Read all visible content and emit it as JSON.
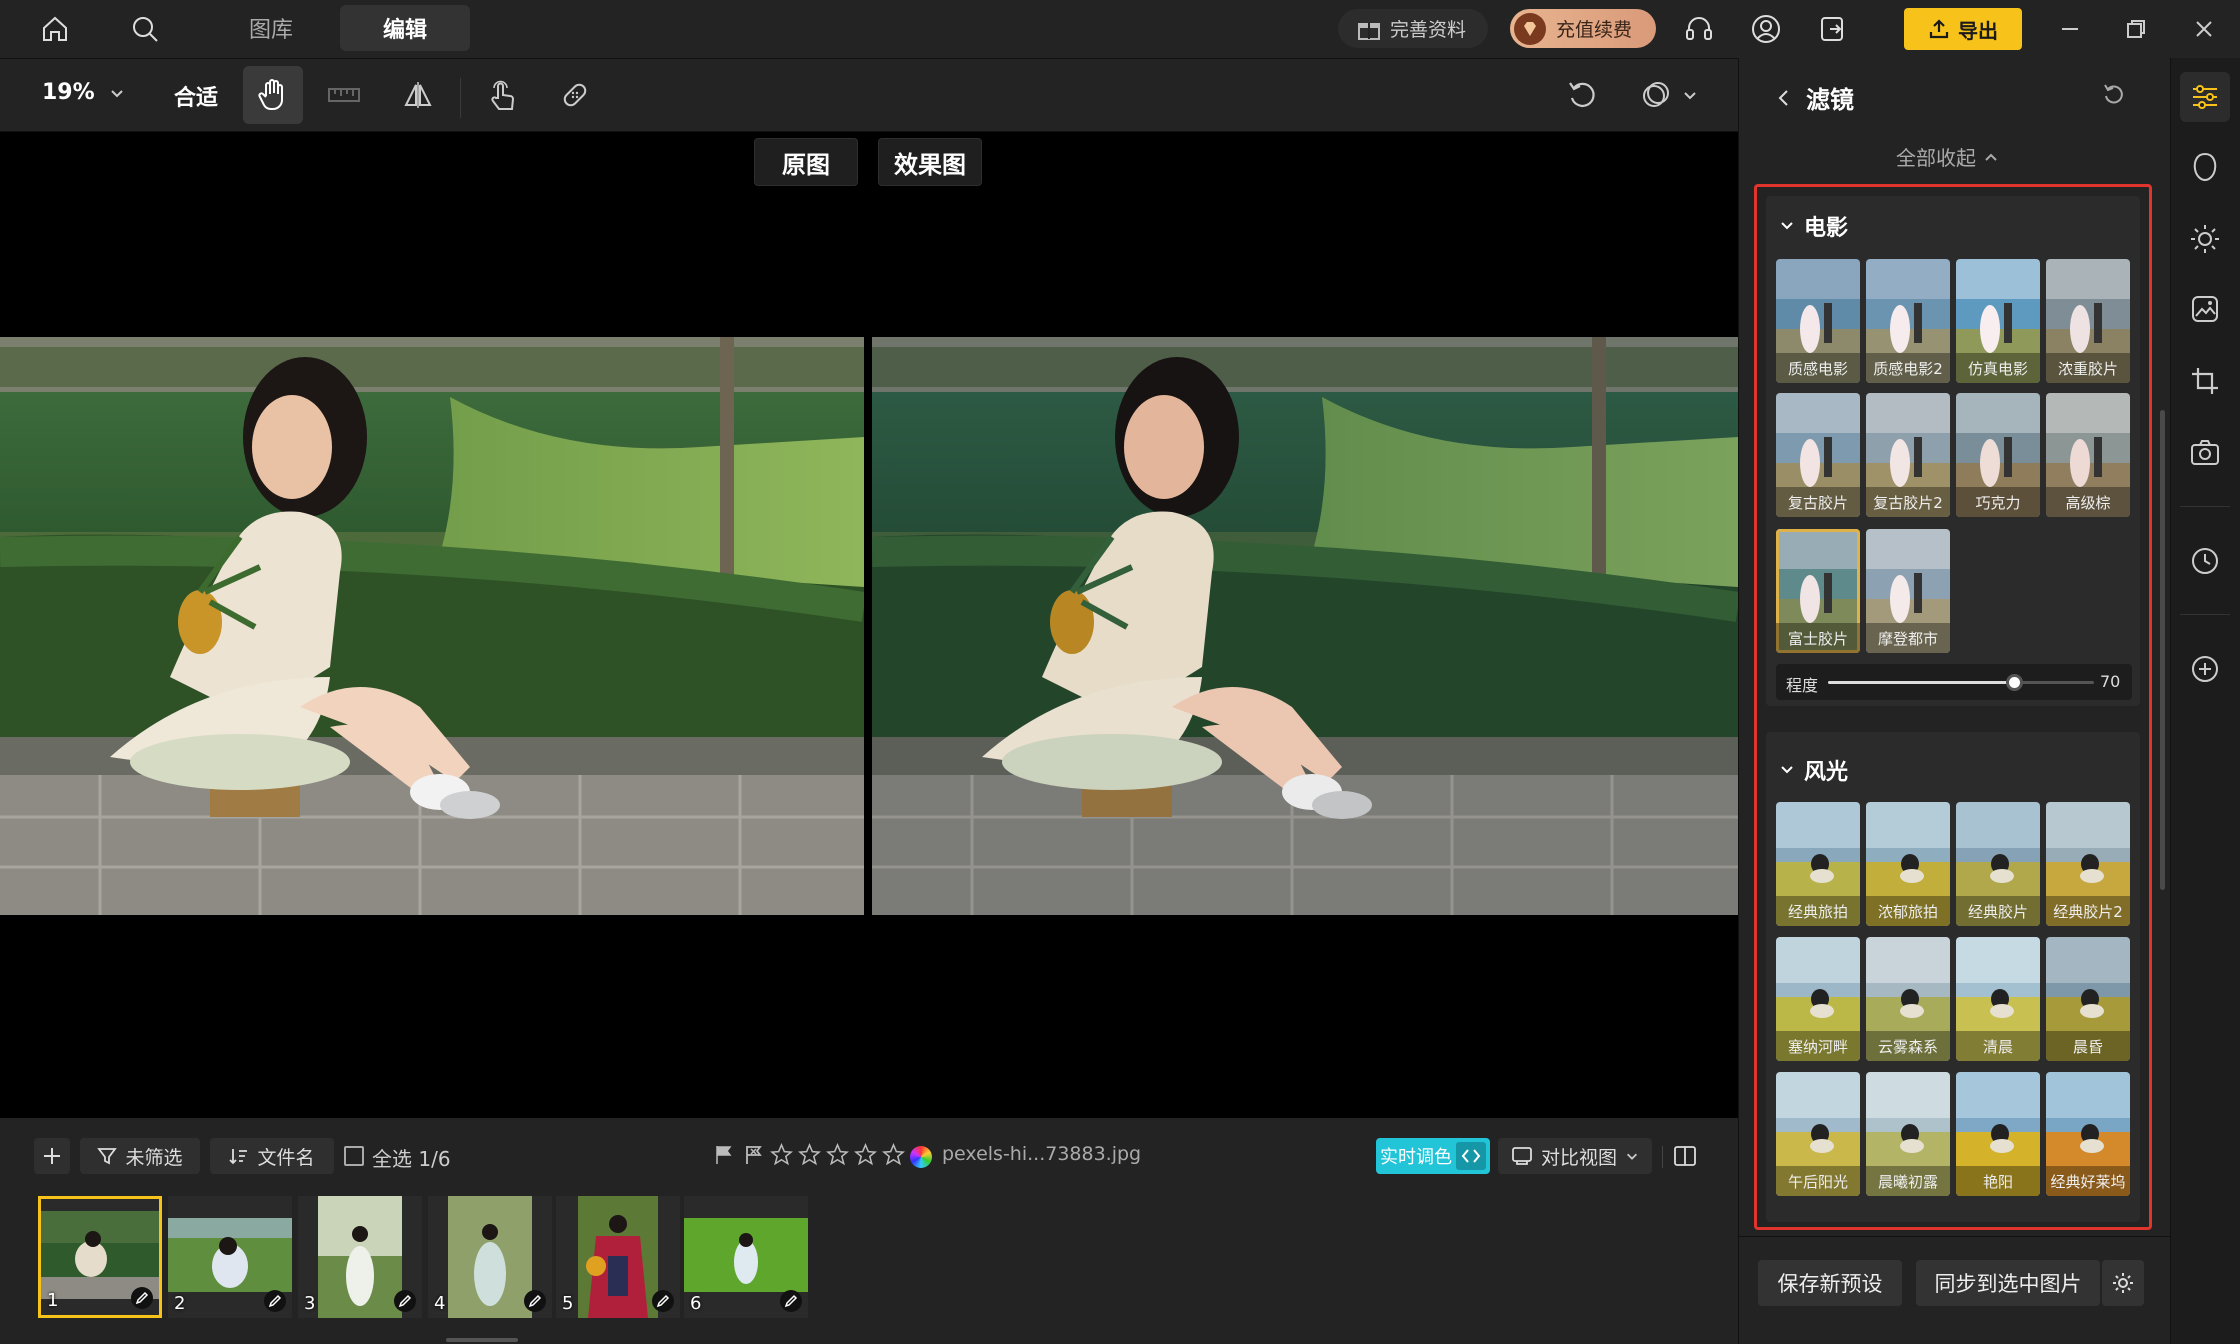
{
  "topbar": {
    "tabs": [
      "图库",
      "编辑"
    ],
    "profile_label": "完善资料",
    "vip_label": "充值续费",
    "export_label": "导出"
  },
  "toolbar": {
    "zoom": "19%",
    "fit_label": "合适"
  },
  "compare": {
    "original_label": "原图",
    "effect_label": "效果图"
  },
  "bottombar": {
    "filter_label": "未筛选",
    "filename_sort_label": "文件名",
    "select_all_label": "全选 1/6",
    "filename": "pexels-hi...73883.jpg",
    "realtime_label": "实时调色",
    "compare_view_label": "对比视图",
    "thumbnails": [
      "1",
      "2",
      "3",
      "4",
      "5",
      "6"
    ]
  },
  "panel": {
    "title": "滤镜",
    "collapse_all_label": "全部收起",
    "sections": [
      {
        "name": "电影",
        "filters": [
          "质感电影",
          "质感电影2",
          "仿真电影",
          "浓重胶片",
          "复古胶片",
          "复古胶片2",
          "巧克力",
          "高级棕",
          "富士胶片",
          "摩登都市"
        ],
        "selected": "富士胶片",
        "strength_label": "程度",
        "strength_value": "70",
        "strength_fraction": 0.7
      },
      {
        "name": "风光",
        "filters": [
          "经典旅拍",
          "浓郁旅拍",
          "经典胶片",
          "经典胶片2",
          "塞纳河畔",
          "云雾森系",
          "清晨",
          "晨昏",
          "午后阳光",
          "晨曦初露",
          "艳阳",
          "经典好莱坞"
        ]
      }
    ],
    "save_preset_label": "保存新预设",
    "sync_label": "同步到选中图片"
  },
  "colors": {
    "accent_yellow": "#f7c21a",
    "selection_border": "#e0b24a",
    "realtime_cyan": "#22c4d8",
    "highlight_red": "#e0342c"
  }
}
